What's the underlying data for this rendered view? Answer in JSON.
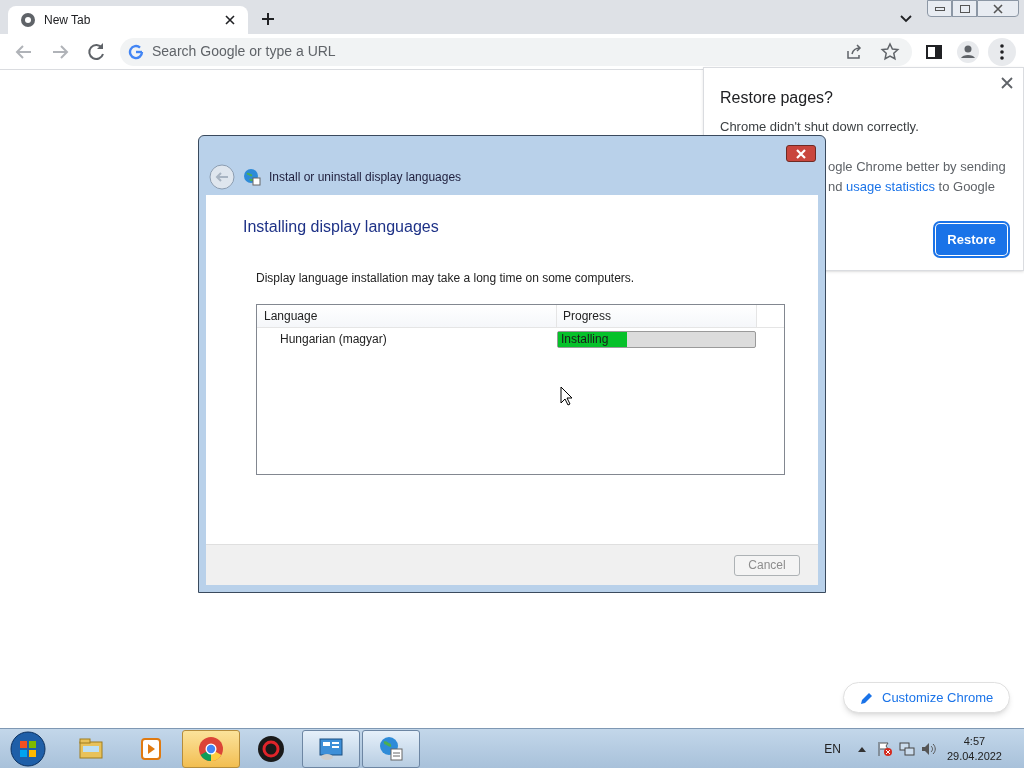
{
  "browser": {
    "tabs": [
      {
        "title": "New Tab",
        "selected": true
      }
    ],
    "address_bar": {
      "placeholder": "Search Google or type a URL"
    }
  },
  "restore_popup": {
    "title": "Restore pages?",
    "message": "Chrome didn't shut down correctly.",
    "line_1": "ogle Chrome better by sending",
    "line_2_before": "nd ",
    "link": "usage statistics",
    "line_2_after": " to Google",
    "button": "Restore"
  },
  "dialog": {
    "title": "Install or uninstall display languages",
    "heading": "Installing display languages",
    "note": "Display language installation may take a long time on some computers.",
    "table": {
      "columns": [
        "Language",
        "Progress"
      ],
      "rows": [
        {
          "language": "Hungarian (magyar)",
          "status": "Installing",
          "level": 0.35
        }
      ]
    },
    "buttons": [
      {
        "label": "Cancel",
        "disabled": true
      }
    ]
  },
  "customize_button": "Customize Chrome",
  "taskbar": {
    "items": [
      {
        "kind": "explorer",
        "open": false,
        "highlighted": false
      },
      {
        "kind": "media",
        "open": false,
        "highlighted": false
      },
      {
        "kind": "chrome",
        "open": true,
        "highlighted": true
      },
      {
        "kind": "app",
        "open": false,
        "highlighted": false
      },
      {
        "kind": "control",
        "open": true,
        "highlighted": false
      },
      {
        "kind": "language",
        "open": true,
        "highlighted": false
      }
    ],
    "language": "EN",
    "time": "4:57",
    "date": "29.04.2022"
  }
}
